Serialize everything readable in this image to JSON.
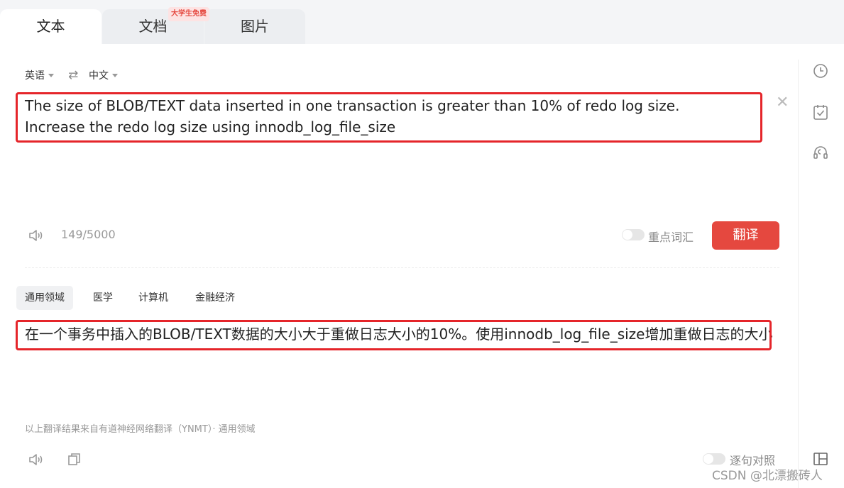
{
  "tabs": [
    {
      "label": "文本"
    },
    {
      "label": "文档"
    },
    {
      "label": "图片"
    }
  ],
  "badge": "大学生免费",
  "source_lang": "英语",
  "target_lang": "中文",
  "input": {
    "text": "The size of BLOB/TEXT data inserted in one transaction is greater than 10% of redo log size.    Increase the redo log size using innodb_log_file_size",
    "char_count": "149/5000"
  },
  "key_terms_label": "重点词汇",
  "translate_button": "翻译",
  "domains": [
    {
      "label": "通用领域"
    },
    {
      "label": "医学"
    },
    {
      "label": "计算机"
    },
    {
      "label": "金融经济"
    }
  ],
  "output": {
    "text": "在一个事务中插入的BLOB/TEXT数据的大小大于重做日志大小的10%。使用innodb_log_file_size增加重做日志的大小"
  },
  "footnote": "以上翻译结果来自有道神经网络翻译（YNMT）· 通用领域",
  "sentence_align_label": "逐句对照",
  "watermark": "CSDN @北漂搬砖人",
  "colors": {
    "accent": "#e5483f",
    "highlight_box": "#e5252a"
  }
}
